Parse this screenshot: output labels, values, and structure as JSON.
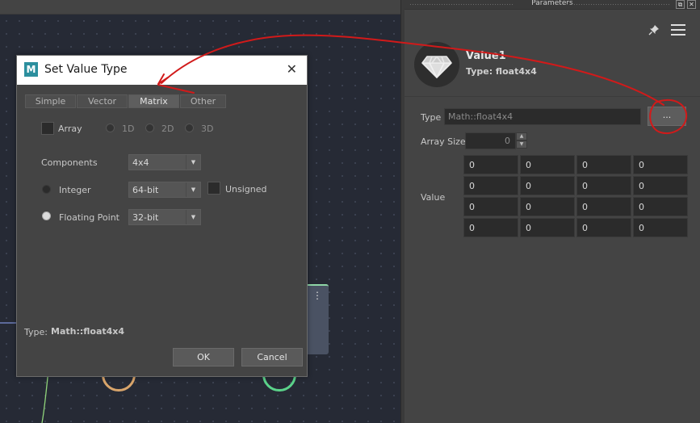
{
  "params": {
    "title": "Parameters",
    "node_name": "Value1",
    "node_type": "Type: float4x4",
    "type_label": "Type",
    "type_value": "Math::float4x4",
    "browse_button": "...",
    "array_size_label": "Array Size",
    "array_size_value": "0",
    "value_label": "Value",
    "matrix": [
      [
        "0",
        "0",
        "0",
        "0"
      ],
      [
        "0",
        "0",
        "0",
        "0"
      ],
      [
        "0",
        "0",
        "0",
        "0"
      ],
      [
        "0",
        "0",
        "0",
        "0"
      ]
    ]
  },
  "dialog": {
    "title": "Set Value Type",
    "logo": "M",
    "tabs": [
      "Simple",
      "Vector",
      "Matrix",
      "Other"
    ],
    "active_tab": "Matrix",
    "array_label": "Array",
    "dims": [
      "1D",
      "2D",
      "3D"
    ],
    "components_label": "Components",
    "components_value": "4x4",
    "integer_label": "Integer",
    "integer_bits": "64-bit",
    "unsigned_label": "Unsigned",
    "floating_label": "Floating Point",
    "floating_bits": "32-bit",
    "type_prefix": "Type:",
    "type_value": "Math::float4x4",
    "ok_label": "OK",
    "cancel_label": "Cancel"
  },
  "icons": {
    "pin": "pin-icon",
    "menu": "hamburger-menu-icon",
    "diamond": "diamond-icon",
    "close": "close-icon",
    "dropdown": "chevron-down-icon"
  },
  "colors": {
    "annotation": "#d11a1a",
    "graph_bg": "#262a35",
    "accent_green": "#5bd38a",
    "accent_orange": "#d9a56b"
  }
}
